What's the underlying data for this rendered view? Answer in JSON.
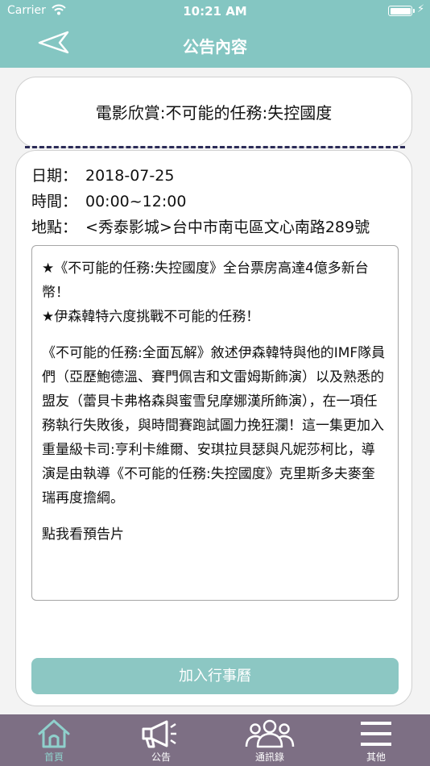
{
  "status_bar": {
    "carrier": "Carrier",
    "time": "10:21 AM"
  },
  "nav": {
    "title": "公告內容",
    "back_icon": "back-arrow-icon"
  },
  "announcement": {
    "title": "電影欣賞:不可能的任務:失控國度",
    "date_label": "日期：",
    "date": "2018-07-25",
    "time_label": "時間：",
    "time": "00:00~12:00",
    "location_label": "地點：",
    "location": "<秀泰影城>台中市南屯區文心南路289號",
    "highlight1": "★《不可能的任務:失控國度》全台票房高達4億多新台幣！",
    "highlight2": "★伊森韓特六度挑戰不可能的任務！",
    "body": "《不可能的任務:全面瓦解》敘述伊森韓特與他的IMF隊員們（亞歷鮑德溫、賽門佩吉和文雷姆斯飾演）以及熟悉的盟友（蕾貝卡弗格森與蜜雪兒摩娜漢所飾演），在一項任務執行失敗後，與時間賽跑試圖力挽狂瀾！這一集更加入重量級卡司:亨利卡維爾、安琪拉貝瑟與凡妮莎柯比，導演是由執導《不可能的任務:失控國度》克里斯多夫麥奎瑞再度擔綱。",
    "trailer_link": "點我看預告片"
  },
  "add_button": "加入行事曆",
  "tabs": [
    {
      "label": "首頁",
      "icon": "home-icon",
      "active": true
    },
    {
      "label": "公告",
      "icon": "megaphone-icon",
      "active": false
    },
    {
      "label": "通訊錄",
      "icon": "contacts-icon",
      "active": false
    },
    {
      "label": "其他",
      "icon": "menu-icon",
      "active": false
    }
  ],
  "colors": {
    "header": "#84c6c2",
    "tabbar": "#7d6f84",
    "button": "#8cc7c3",
    "active_tab": "#8fd0cc",
    "divider": "#2c2c58"
  }
}
